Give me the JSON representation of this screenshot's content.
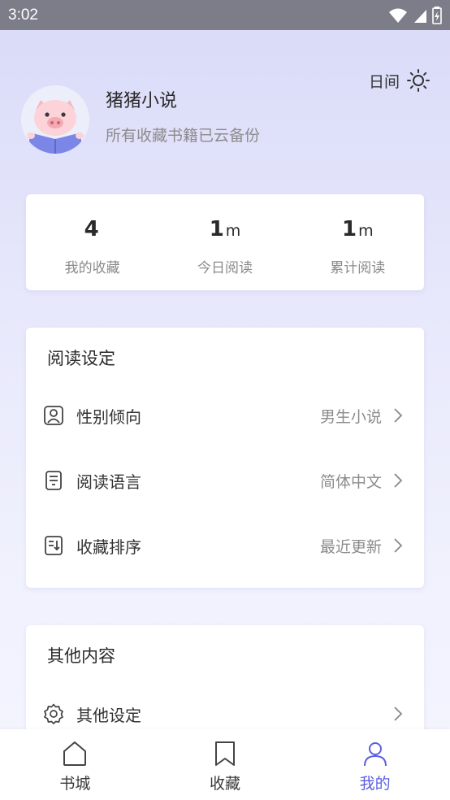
{
  "status_bar": {
    "time": "3:02"
  },
  "mode_toggle": {
    "label": "日间",
    "icon": "sun-icon"
  },
  "profile": {
    "name": "猪猪小说",
    "subtitle": "所有收藏书籍已云备份",
    "avatar": "pig-reading-avatar"
  },
  "stats": [
    {
      "value": "4",
      "unit": "",
      "label": "我的收藏"
    },
    {
      "value": "1",
      "unit": "m",
      "label": "今日阅读"
    },
    {
      "value": "1",
      "unit": "m",
      "label": "累计阅读"
    }
  ],
  "reading_settings": {
    "title": "阅读设定",
    "items": [
      {
        "icon": "gender-icon",
        "label": "性别倾向",
        "value": "男生小说"
      },
      {
        "icon": "language-icon",
        "label": "阅读语言",
        "value": "简体中文"
      },
      {
        "icon": "sort-icon",
        "label": "收藏排序",
        "value": "最近更新"
      }
    ]
  },
  "other": {
    "title": "其他内容",
    "items": [
      {
        "icon": "gear-icon",
        "label": "其他设定"
      }
    ]
  },
  "tabbar": {
    "tabs": [
      {
        "label": "书城",
        "icon": "home-icon",
        "active": false
      },
      {
        "label": "收藏",
        "icon": "bookmark-icon",
        "active": false
      },
      {
        "label": "我的",
        "icon": "user-icon",
        "active": true
      }
    ],
    "active_color": "#5b5fe0"
  }
}
